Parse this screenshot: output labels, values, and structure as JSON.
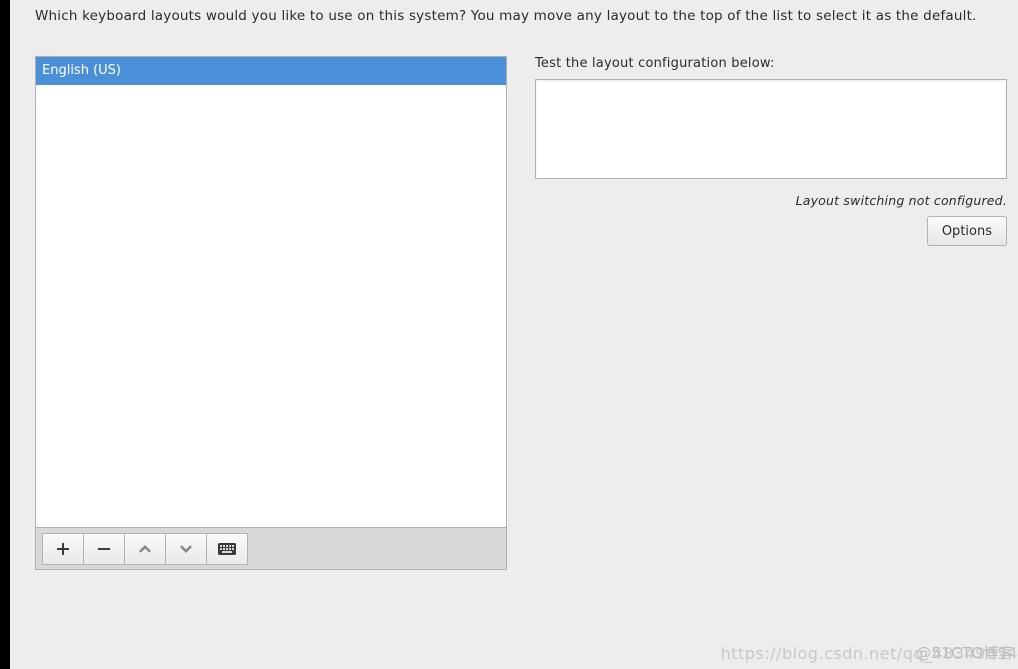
{
  "prompt": "Which keyboard layouts would you like to use on this system?  You may move any layout to the top of the list to select it as the default.",
  "layouts": {
    "items": [
      "English (US)"
    ],
    "selected_index": 0
  },
  "toolbar": {
    "add": "add-icon",
    "remove": "remove-icon",
    "move_up": "chevron-up-icon",
    "move_down": "chevron-down-icon",
    "preview": "keyboard-icon"
  },
  "test": {
    "label": "Test the layout configuration below:",
    "value": ""
  },
  "switch_status": "Layout switching not configured.",
  "options_label": "Options",
  "watermark_back": "https://blog.csdn.net/qq_48349054",
  "watermark_front": "@51CTO博客"
}
